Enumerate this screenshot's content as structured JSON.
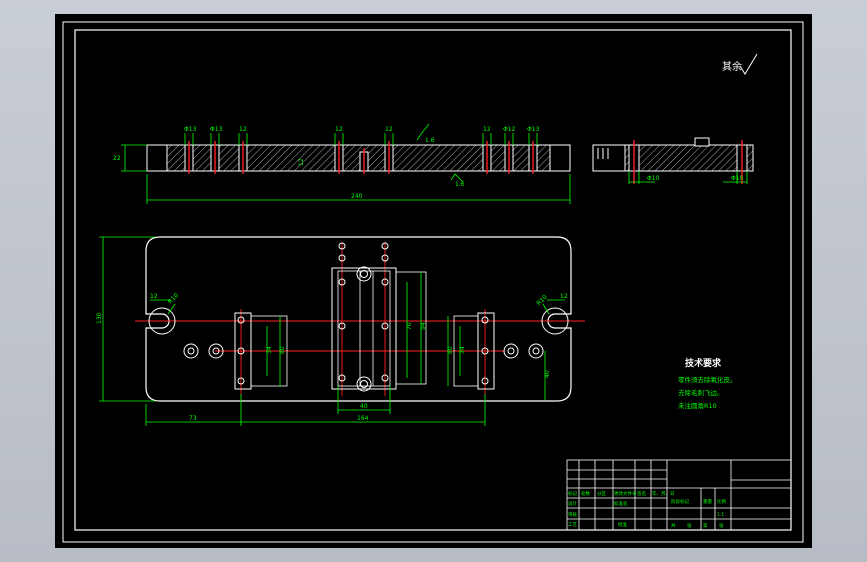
{
  "drawing": {
    "roughness_note": "其余",
    "front_view": {
      "dim_labels_top": [
        "Φ13",
        "Φ13",
        "12",
        "12",
        "12",
        "12",
        "Φ12",
        "Φ13"
      ],
      "height_dim": "22",
      "length_dim": "240",
      "roughness_marks": [
        "1.6",
        "1.6"
      ],
      "inner_dim": "12"
    },
    "side_view": {
      "dims": [
        "Φ10",
        "Φ10"
      ]
    },
    "plan_view": {
      "width_dim": "130",
      "r_left": "R10",
      "w_left": "12",
      "r_right": "R10",
      "w_right": "12",
      "center_dims": [
        "70",
        "94"
      ],
      "left_block_dims": [
        "34",
        "80"
      ],
      "right_block_dims": [
        "34",
        "80"
      ],
      "bottom_dim_center": "40",
      "right_dim": "40",
      "overall_dim_left": "73",
      "overall_dim_main": "164"
    },
    "tech_requirements": {
      "title": "技术要求",
      "lines": [
        "零件须去除氧化皮。",
        "去除毛刺飞边。",
        "未注圆角R10"
      ]
    },
    "title_block": {
      "labels": [
        "标记",
        "处数",
        "分区",
        "更改文件号",
        "签名",
        "年、月、日",
        "设计",
        "标准化",
        "审核",
        "工艺",
        "批准",
        "阶段标记",
        "重量",
        "比例",
        "共",
        "张",
        "第",
        "张",
        "1:1"
      ]
    }
  }
}
